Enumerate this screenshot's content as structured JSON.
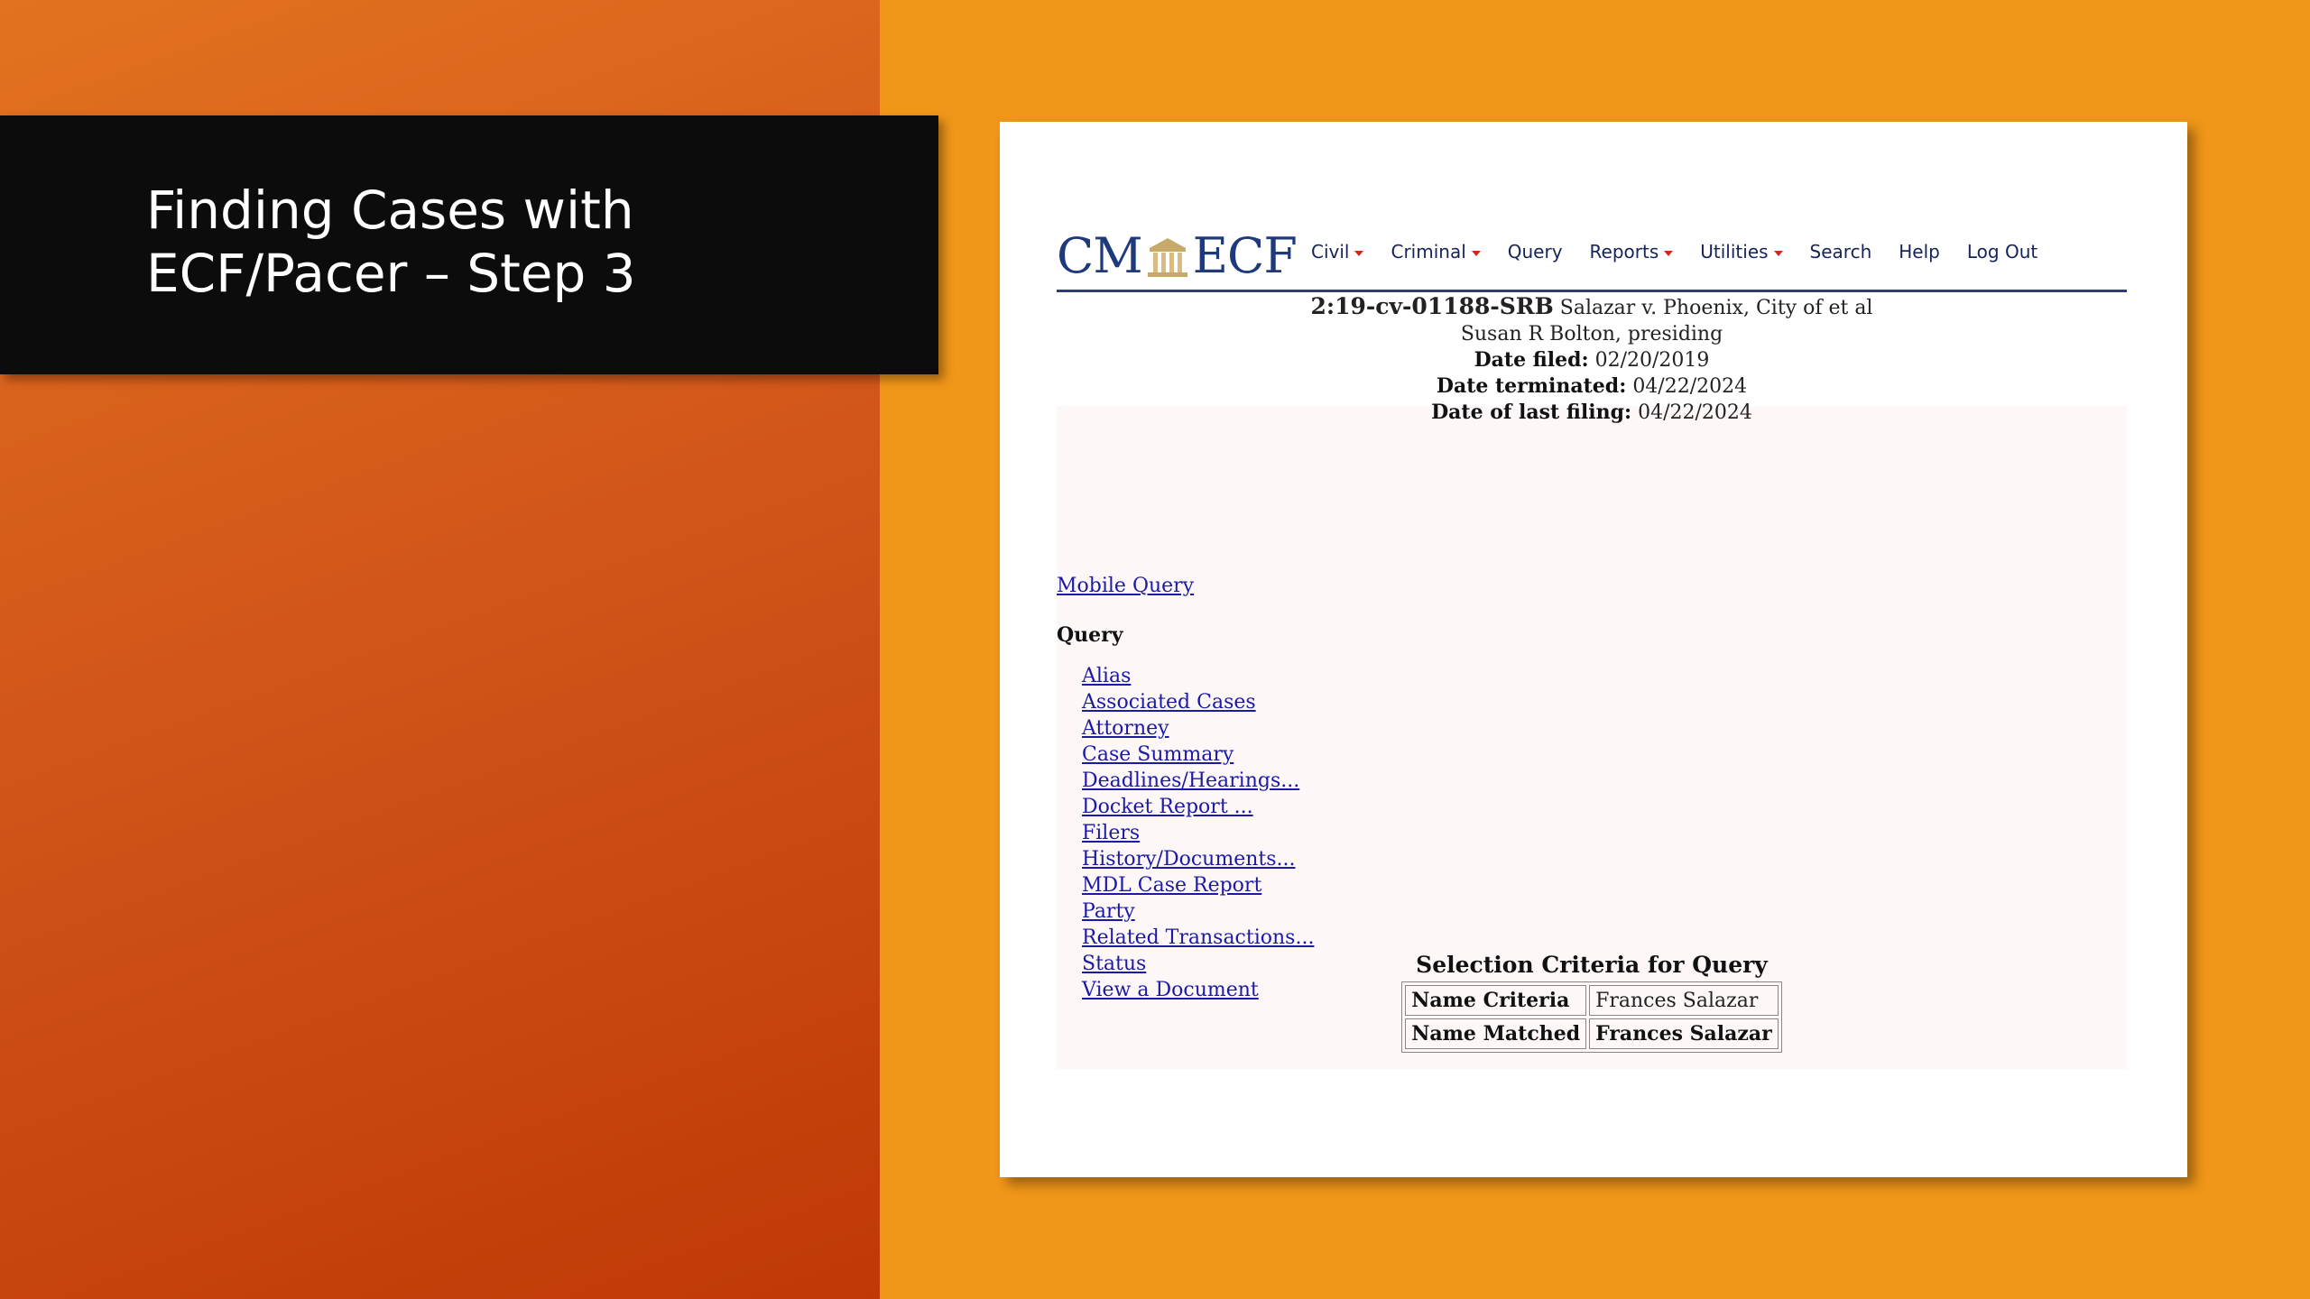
{
  "slide": {
    "title_line1": "Finding Cases with",
    "title_line2": "ECF/Pacer – Step 3"
  },
  "app": {
    "logo_left": "CM",
    "logo_right": "ECF",
    "logo_color": "#1f3a7a"
  },
  "nav": {
    "items": [
      {
        "label": "Civil",
        "has_dropdown": true
      },
      {
        "label": "Criminal",
        "has_dropdown": true
      },
      {
        "label": "Query",
        "has_dropdown": false
      },
      {
        "label": "Reports",
        "has_dropdown": true
      },
      {
        "label": "Utilities",
        "has_dropdown": true
      },
      {
        "label": "Search",
        "has_dropdown": false
      },
      {
        "label": "Help",
        "has_dropdown": false
      },
      {
        "label": "Log Out",
        "has_dropdown": false
      }
    ]
  },
  "case": {
    "number": "2:19-cv-01188-SRB",
    "title": "Salazar v. Phoenix, City of et al",
    "judge": "Susan R Bolton, presiding",
    "date_filed_label": "Date filed:",
    "date_filed": "02/20/2019",
    "date_terminated_label": "Date terminated:",
    "date_terminated": "04/22/2024",
    "date_last_filing_label": "Date of last filing:",
    "date_last_filing": "04/22/2024"
  },
  "links": {
    "mobile_query": "Mobile Query"
  },
  "query": {
    "heading": "Query",
    "items": [
      "Alias",
      "Associated Cases",
      "Attorney",
      "Case Summary",
      "Deadlines/Hearings...",
      "Docket Report ...",
      "Filers",
      "History/Documents...",
      "MDL Case Report",
      "Party",
      "Related Transactions...",
      "Status",
      "View a Document"
    ]
  },
  "criteria": {
    "title": "Selection Criteria for Query",
    "rows": [
      {
        "label": "Name Criteria",
        "value": "Frances Salazar"
      },
      {
        "label": "Name Matched",
        "value": "Frances Salazar"
      }
    ]
  },
  "colors": {
    "orange_bg": "#f09619",
    "title_box": "#0c0c0c",
    "link": "#1a1aa6",
    "caret": "#d0281f"
  }
}
